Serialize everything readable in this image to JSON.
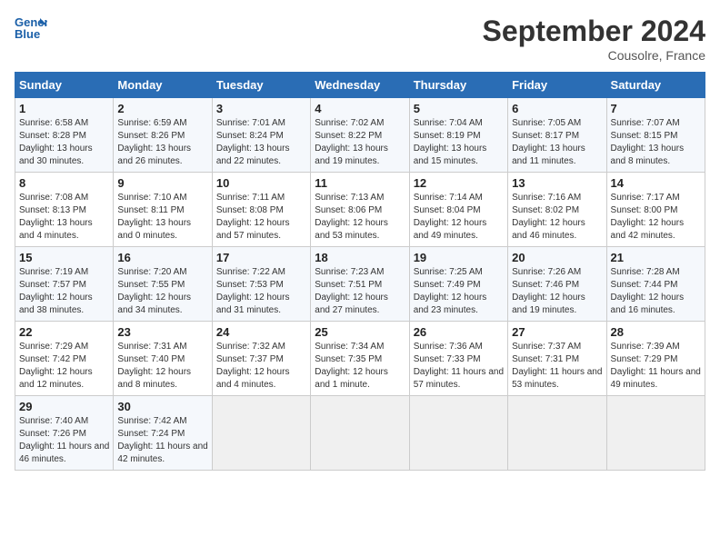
{
  "header": {
    "logo_line1": "General",
    "logo_line2": "Blue",
    "month_title": "September 2024",
    "location": "Cousolre, France"
  },
  "weekdays": [
    "Sunday",
    "Monday",
    "Tuesday",
    "Wednesday",
    "Thursday",
    "Friday",
    "Saturday"
  ],
  "weeks": [
    [
      {
        "day": "1",
        "sunrise": "Sunrise: 6:58 AM",
        "sunset": "Sunset: 8:28 PM",
        "daylight": "Daylight: 13 hours and 30 minutes."
      },
      {
        "day": "2",
        "sunrise": "Sunrise: 6:59 AM",
        "sunset": "Sunset: 8:26 PM",
        "daylight": "Daylight: 13 hours and 26 minutes."
      },
      {
        "day": "3",
        "sunrise": "Sunrise: 7:01 AM",
        "sunset": "Sunset: 8:24 PM",
        "daylight": "Daylight: 13 hours and 22 minutes."
      },
      {
        "day": "4",
        "sunrise": "Sunrise: 7:02 AM",
        "sunset": "Sunset: 8:22 PM",
        "daylight": "Daylight: 13 hours and 19 minutes."
      },
      {
        "day": "5",
        "sunrise": "Sunrise: 7:04 AM",
        "sunset": "Sunset: 8:19 PM",
        "daylight": "Daylight: 13 hours and 15 minutes."
      },
      {
        "day": "6",
        "sunrise": "Sunrise: 7:05 AM",
        "sunset": "Sunset: 8:17 PM",
        "daylight": "Daylight: 13 hours and 11 minutes."
      },
      {
        "day": "7",
        "sunrise": "Sunrise: 7:07 AM",
        "sunset": "Sunset: 8:15 PM",
        "daylight": "Daylight: 13 hours and 8 minutes."
      }
    ],
    [
      {
        "day": "8",
        "sunrise": "Sunrise: 7:08 AM",
        "sunset": "Sunset: 8:13 PM",
        "daylight": "Daylight: 13 hours and 4 minutes."
      },
      {
        "day": "9",
        "sunrise": "Sunrise: 7:10 AM",
        "sunset": "Sunset: 8:11 PM",
        "daylight": "Daylight: 13 hours and 0 minutes."
      },
      {
        "day": "10",
        "sunrise": "Sunrise: 7:11 AM",
        "sunset": "Sunset: 8:08 PM",
        "daylight": "Daylight: 12 hours and 57 minutes."
      },
      {
        "day": "11",
        "sunrise": "Sunrise: 7:13 AM",
        "sunset": "Sunset: 8:06 PM",
        "daylight": "Daylight: 12 hours and 53 minutes."
      },
      {
        "day": "12",
        "sunrise": "Sunrise: 7:14 AM",
        "sunset": "Sunset: 8:04 PM",
        "daylight": "Daylight: 12 hours and 49 minutes."
      },
      {
        "day": "13",
        "sunrise": "Sunrise: 7:16 AM",
        "sunset": "Sunset: 8:02 PM",
        "daylight": "Daylight: 12 hours and 46 minutes."
      },
      {
        "day": "14",
        "sunrise": "Sunrise: 7:17 AM",
        "sunset": "Sunset: 8:00 PM",
        "daylight": "Daylight: 12 hours and 42 minutes."
      }
    ],
    [
      {
        "day": "15",
        "sunrise": "Sunrise: 7:19 AM",
        "sunset": "Sunset: 7:57 PM",
        "daylight": "Daylight: 12 hours and 38 minutes."
      },
      {
        "day": "16",
        "sunrise": "Sunrise: 7:20 AM",
        "sunset": "Sunset: 7:55 PM",
        "daylight": "Daylight: 12 hours and 34 minutes."
      },
      {
        "day": "17",
        "sunrise": "Sunrise: 7:22 AM",
        "sunset": "Sunset: 7:53 PM",
        "daylight": "Daylight: 12 hours and 31 minutes."
      },
      {
        "day": "18",
        "sunrise": "Sunrise: 7:23 AM",
        "sunset": "Sunset: 7:51 PM",
        "daylight": "Daylight: 12 hours and 27 minutes."
      },
      {
        "day": "19",
        "sunrise": "Sunrise: 7:25 AM",
        "sunset": "Sunset: 7:49 PM",
        "daylight": "Daylight: 12 hours and 23 minutes."
      },
      {
        "day": "20",
        "sunrise": "Sunrise: 7:26 AM",
        "sunset": "Sunset: 7:46 PM",
        "daylight": "Daylight: 12 hours and 19 minutes."
      },
      {
        "day": "21",
        "sunrise": "Sunrise: 7:28 AM",
        "sunset": "Sunset: 7:44 PM",
        "daylight": "Daylight: 12 hours and 16 minutes."
      }
    ],
    [
      {
        "day": "22",
        "sunrise": "Sunrise: 7:29 AM",
        "sunset": "Sunset: 7:42 PM",
        "daylight": "Daylight: 12 hours and 12 minutes."
      },
      {
        "day": "23",
        "sunrise": "Sunrise: 7:31 AM",
        "sunset": "Sunset: 7:40 PM",
        "daylight": "Daylight: 12 hours and 8 minutes."
      },
      {
        "day": "24",
        "sunrise": "Sunrise: 7:32 AM",
        "sunset": "Sunset: 7:37 PM",
        "daylight": "Daylight: 12 hours and 4 minutes."
      },
      {
        "day": "25",
        "sunrise": "Sunrise: 7:34 AM",
        "sunset": "Sunset: 7:35 PM",
        "daylight": "Daylight: 12 hours and 1 minute."
      },
      {
        "day": "26",
        "sunrise": "Sunrise: 7:36 AM",
        "sunset": "Sunset: 7:33 PM",
        "daylight": "Daylight: 11 hours and 57 minutes."
      },
      {
        "day": "27",
        "sunrise": "Sunrise: 7:37 AM",
        "sunset": "Sunset: 7:31 PM",
        "daylight": "Daylight: 11 hours and 53 minutes."
      },
      {
        "day": "28",
        "sunrise": "Sunrise: 7:39 AM",
        "sunset": "Sunset: 7:29 PM",
        "daylight": "Daylight: 11 hours and 49 minutes."
      }
    ],
    [
      {
        "day": "29",
        "sunrise": "Sunrise: 7:40 AM",
        "sunset": "Sunset: 7:26 PM",
        "daylight": "Daylight: 11 hours and 46 minutes."
      },
      {
        "day": "30",
        "sunrise": "Sunrise: 7:42 AM",
        "sunset": "Sunset: 7:24 PM",
        "daylight": "Daylight: 11 hours and 42 minutes."
      },
      null,
      null,
      null,
      null,
      null
    ]
  ]
}
